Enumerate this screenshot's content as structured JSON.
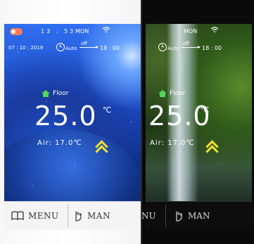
{
  "units": {
    "white": {
      "status": {
        "time": "13 : 53",
        "day": "MON"
      },
      "date": "07 : 10 : 2019",
      "mode": {
        "label": "Auto",
        "off_label": "off",
        "time": "18 : 00"
      },
      "sensor": {
        "label": "Floor"
      },
      "temperature": {
        "value": "25.0",
        "unit": "℃"
      },
      "air": {
        "label": "Air:",
        "value": "17.0",
        "unit": "℃"
      },
      "buttons": {
        "menu": "MENU",
        "man": "MAN"
      }
    },
    "black": {
      "status": {
        "day": "MON"
      },
      "mode": {
        "label": "Auto",
        "off_label": "off",
        "time": "18 : 00"
      },
      "sensor": {
        "label": "Floor"
      },
      "temperature": {
        "value": "25.0",
        "unit": "℃"
      },
      "air": {
        "label": "Air:",
        "value": "17.0",
        "unit": "℃"
      },
      "buttons": {
        "menu": "NU",
        "man": "MAN"
      }
    }
  },
  "colors": {
    "accent_green": "#52d65a",
    "accent_yellow": "#f0e12a",
    "toggle_orange": "#ff7a59"
  }
}
